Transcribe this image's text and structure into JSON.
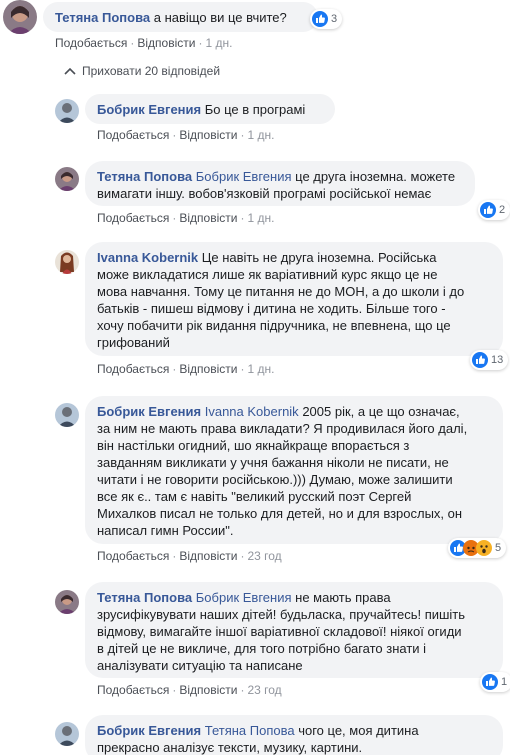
{
  "comments": [
    {
      "author": "Тетяна Попова",
      "tag": "",
      "text": "а навіщо ви це вчите?",
      "like": "Подобається",
      "reply": "Відповісти",
      "time": "1 дн.",
      "reactions": "3"
    },
    {
      "author": "Бобрик Евгения",
      "tag": "",
      "text": "Бо це в програмі",
      "like": "Подобається",
      "reply": "Відповісти",
      "time": "1 дн."
    },
    {
      "author": "Тетяна Попова",
      "tag": "Бобрик Евгения",
      "text_lines": [
        "це друга іноземна. можете",
        "вимагати іншу. вобов'язковій програмі російської немає"
      ],
      "like": "Подобається",
      "reply": "Відповісти",
      "time": "1 дн.",
      "reactions": "2"
    },
    {
      "author": "Ivanna Kobernik",
      "tag": "",
      "text_lines": [
        "Це навіть не друга іноземна. Російська",
        "може викладатися лише як варіативний курс якщо це не",
        "мова навчання. Тому це питання не до МОН, а до школи і до",
        "батьків - пишеш відмову і дитина не ходить. Більше того -",
        "хочу побачити рік видання підручника, не впевнена, що це",
        "грифований"
      ],
      "like": "Подобається",
      "reply": "Відповісти",
      "time": "1 дн.",
      "reactions": "13"
    },
    {
      "author": "Бобрик Евгения",
      "tag": "Ivanna Kobernik",
      "text_lines": [
        "2005 рік, а це що означає,",
        "за ним не мають права викладати? Я продивилася його далі,",
        "він настільки огидний, шо якнайкраще впорається з",
        "завданням викликати у учня бажання ніколи не писати, не",
        "читати і не говорити російською.))) Думаю, може залишити",
        "все як є.. там є навіть \"великий русский поэт Сергей",
        "Михалков писал не только для детей, но и для взрослых, он",
        "написал гимн России\"."
      ],
      "like": "Подобається",
      "reply": "Відповісти",
      "time": "23 год",
      "reactions": "5"
    },
    {
      "author": "Тетяна Попова",
      "tag": "Бобрик Евгения",
      "text_lines": [
        "не мають права",
        "зрусифікувувати наших дітей! будьласка, пручайтесь! пишіть",
        "відмову, вимагайте іншої варіативної складової! ніякої огиди",
        "в дітей це не викличе, для того потрібно багато знати і",
        "аналізувати ситуацію та написане"
      ],
      "like": "Подобається",
      "reply": "Відповісти",
      "time": "23 год",
      "reactions": "1"
    },
    {
      "author": "Бобрик Евгения",
      "tag": "Тетяна Попова",
      "text_lines": [
        "чого це, моя дитина",
        "прекрасно аналізує тексти, музику, картини."
      ]
    }
  ],
  "hide_replies": "Приховати 20 відповідей",
  "colors": {
    "link": "#385898",
    "bubble": "#f2f3f5",
    "like": "#1877f2",
    "meta": "#606770"
  }
}
